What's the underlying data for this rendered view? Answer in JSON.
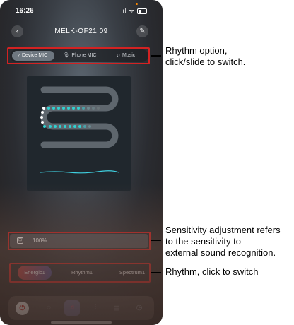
{
  "status_bar": {
    "time": "16:26",
    "signal": "ıl",
    "wifi": "ᯤ"
  },
  "header": {
    "title": "MELK-OF21  09",
    "back_icon": "‹",
    "edit_icon": "✎"
  },
  "mode_tabs": [
    {
      "label": "Device MIC",
      "glyph": "⁄",
      "active": true
    },
    {
      "label": "Phone MIC",
      "glyph": "🎙",
      "active": false
    },
    {
      "label": "Music",
      "glyph": "♫",
      "active": false
    }
  ],
  "sensitivity": {
    "icon": "⊡",
    "value": "100%"
  },
  "rhythm_tabs": [
    {
      "label": "Energic1",
      "active": true
    },
    {
      "label": "Rhythm1",
      "active": false
    },
    {
      "label": "Spectrum1",
      "active": false
    }
  ],
  "nav": {
    "power_icon": "⏻",
    "scene_icon": "◌",
    "music_icon": "♫",
    "eq_icon": "⫶",
    "timer_icon": "◷",
    "other_icon": "▤"
  },
  "annotations": {
    "rhythm_option": [
      "Rhythm option,",
      "click/slide to switch."
    ],
    "sensitivity": [
      "Sensitivity adjustment refers",
      "to the sensitivity to",
      "external sound recognition."
    ],
    "rhythm": [
      "Rhythm, click to switch"
    ]
  }
}
